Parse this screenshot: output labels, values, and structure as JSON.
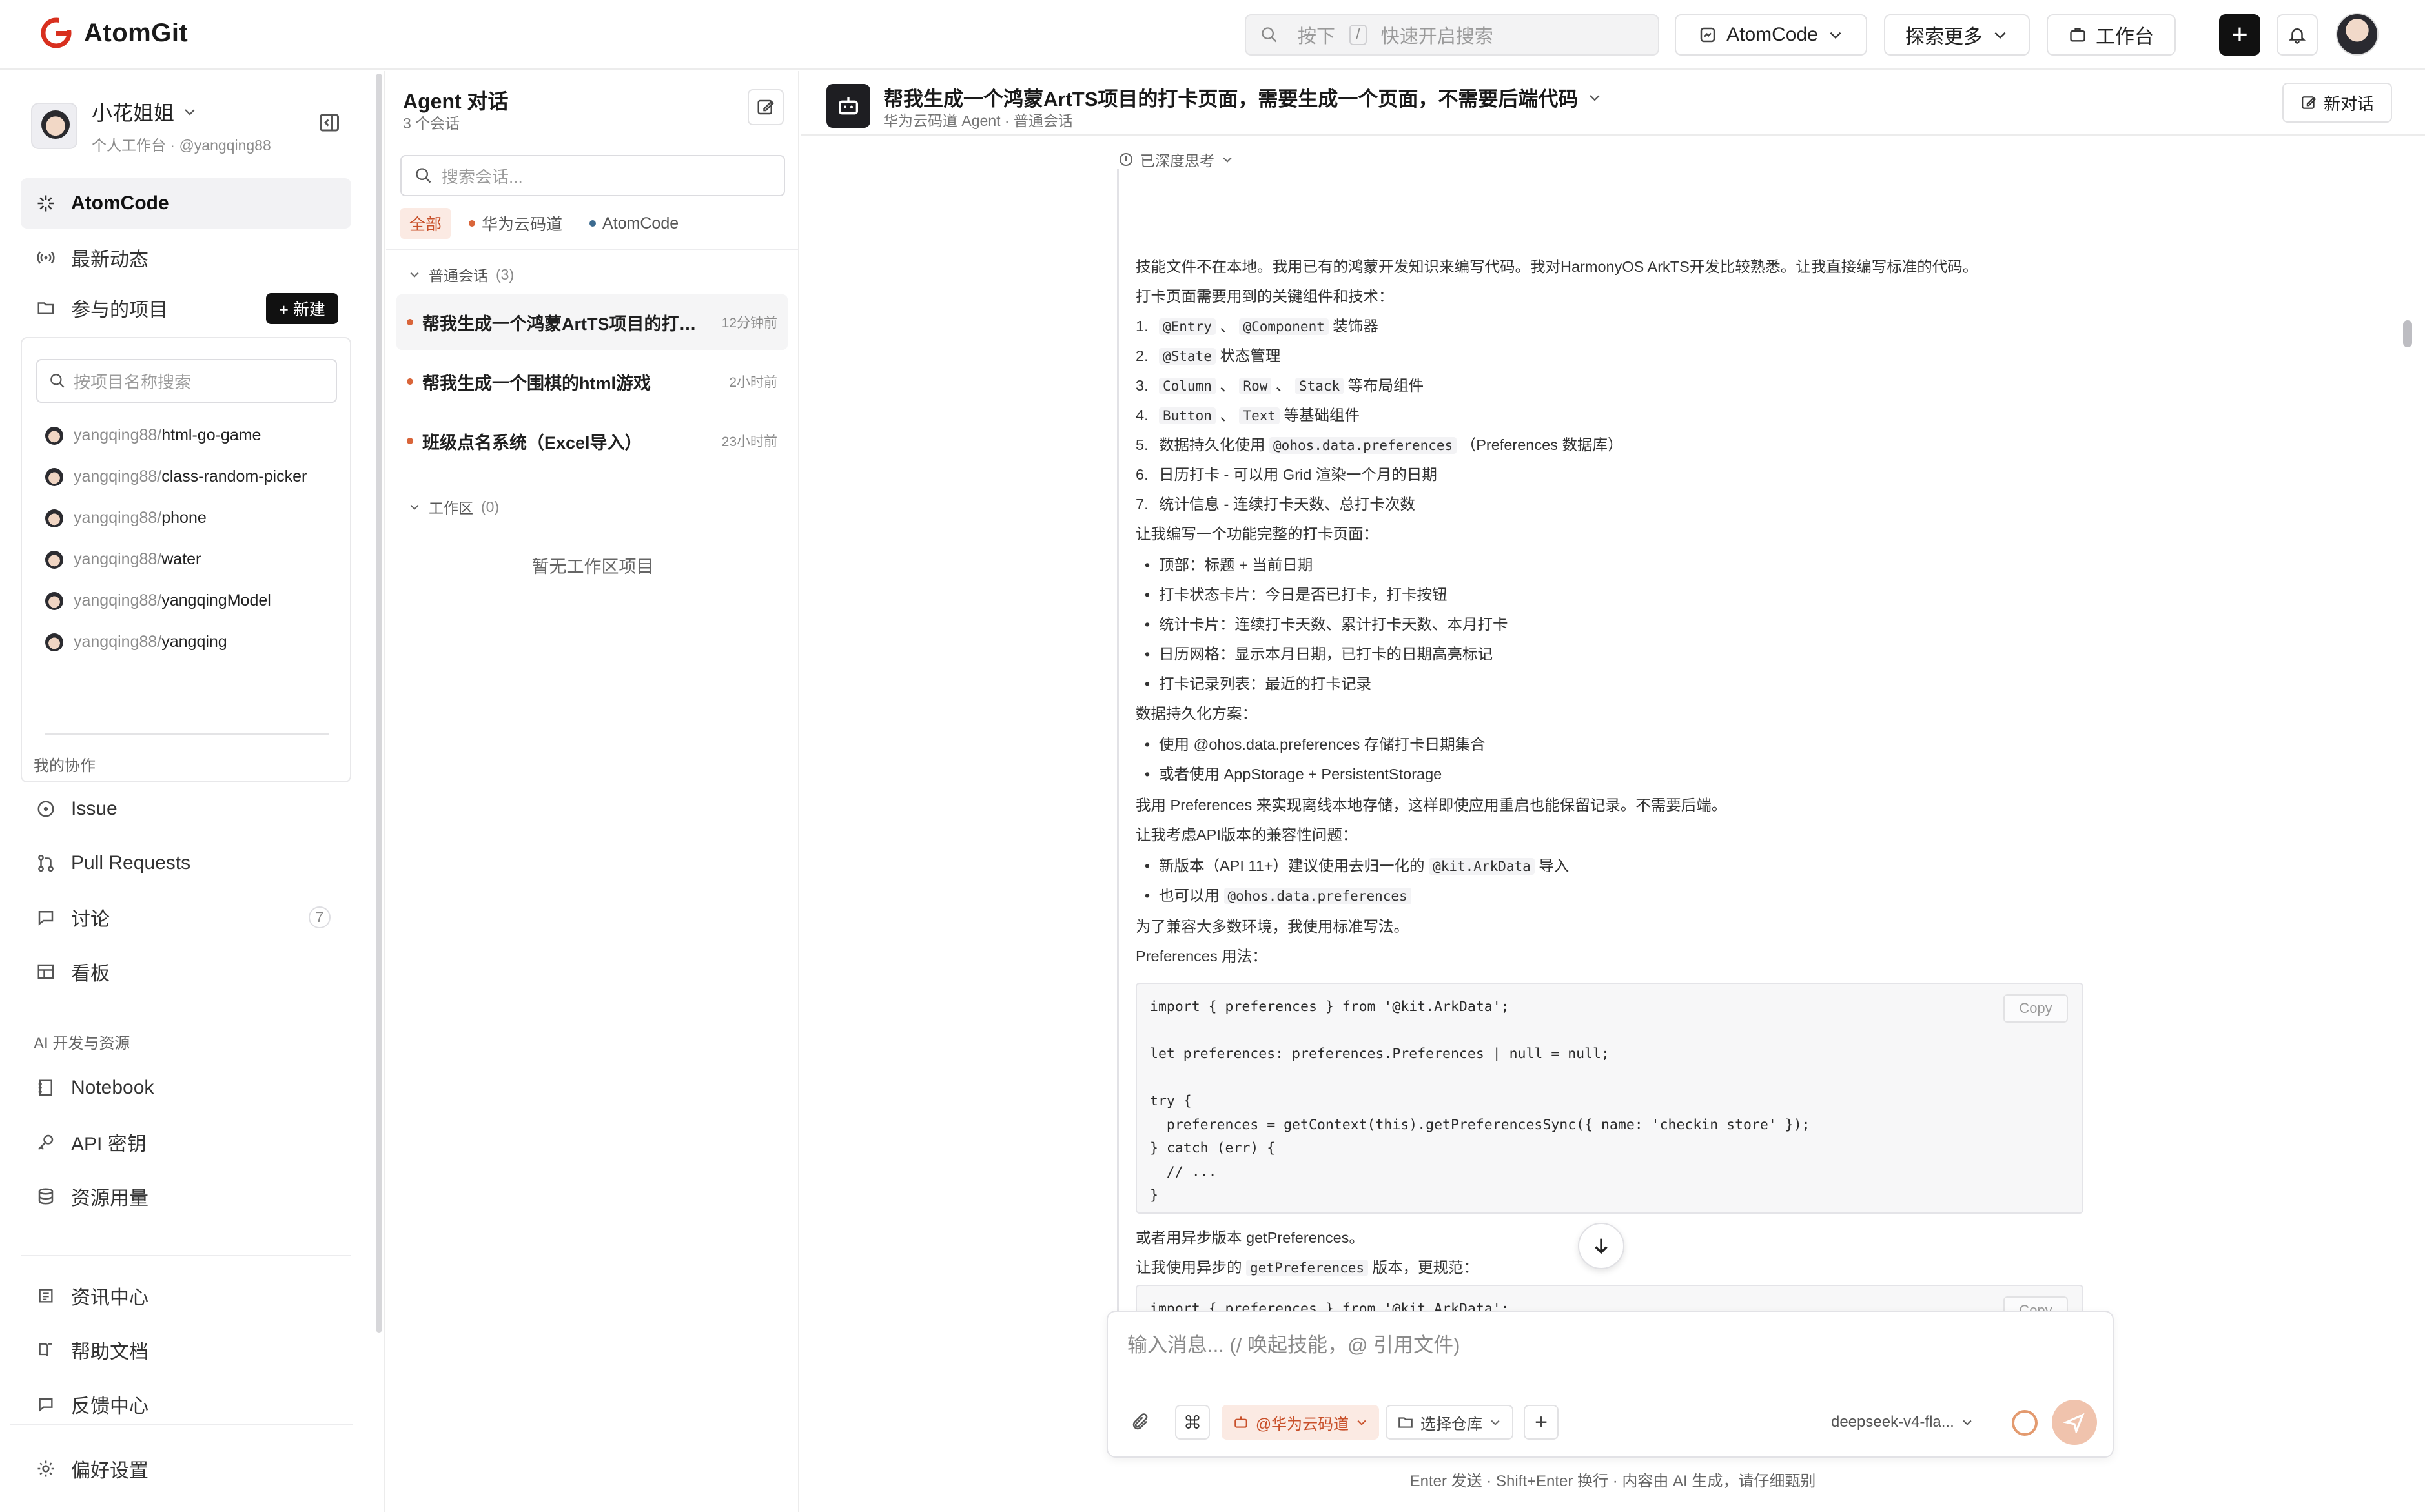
{
  "app": {
    "name": "AtomGit"
  },
  "topbar": {
    "search_placeholder_prefix": "按下",
    "search_key": "/",
    "search_placeholder_suffix": "快速开启搜索",
    "atomcode_label": "AtomCode",
    "explore_label": "探索更多",
    "workbench_label": "工作台"
  },
  "sidebar": {
    "user_name": "小花姐姐",
    "user_sub": "个人工作台 · @yangqing88",
    "nav": [
      {
        "label": "AtomCode",
        "icon": "sparkle-icon"
      },
      {
        "label": "最新动态",
        "icon": "broadcast-icon"
      },
      {
        "label": "参与的项目",
        "icon": "folder-icon"
      }
    ],
    "new_button": "+ 新建",
    "project_search_placeholder": "按项目名称搜索",
    "projects": [
      {
        "owner": "yangqing88/",
        "name": "html-go-game"
      },
      {
        "owner": "yangqing88/",
        "name": "class-random-picker"
      },
      {
        "owner": "yangqing88/",
        "name": "phone"
      },
      {
        "owner": "yangqing88/",
        "name": "water"
      },
      {
        "owner": "yangqing88/",
        "name": "yangqingModel"
      },
      {
        "owner": "yangqing88/",
        "name": "yangqing"
      }
    ],
    "collab_section": "我的协作",
    "collab": [
      {
        "label": "Issue",
        "icon": "issue-icon"
      },
      {
        "label": "Pull Requests",
        "icon": "pull-request-icon"
      },
      {
        "label": "讨论",
        "icon": "chat-icon",
        "badge": "7"
      },
      {
        "label": "看板",
        "icon": "board-icon"
      }
    ],
    "ai_section": "AI 开发与资源",
    "ai": [
      {
        "label": "Notebook",
        "icon": "notebook-icon"
      },
      {
        "label": "API 密钥",
        "icon": "key-icon"
      },
      {
        "label": "资源用量",
        "icon": "database-icon"
      }
    ],
    "bottom": [
      {
        "label": "资讯中心",
        "icon": "news-icon"
      },
      {
        "label": "帮助文档",
        "icon": "book-icon"
      },
      {
        "label": "反馈中心",
        "icon": "feedback-icon"
      }
    ],
    "settings": "偏好设置"
  },
  "conversations": {
    "title": "Agent 对话",
    "count": "3 个会话",
    "search_placeholder": "搜索会话...",
    "filters": [
      "全部",
      "华为云码道",
      "AtomCode"
    ],
    "group_normal": "普通会话",
    "group_normal_count": "(3)",
    "items": [
      {
        "title": "帮我生成一个鸿蒙ArtTS项目的打卡页面，需要生成一个页面，不需要后端代码",
        "time": "12分钟前"
      },
      {
        "title": "帮我生成一个围棋的html游戏",
        "time": "2小时前"
      },
      {
        "title": "班级点名系统（Excel导入）",
        "time": "23小时前"
      }
    ],
    "group_workspace": "工作区",
    "group_workspace_count": "(0)",
    "empty_workspace": "暂无工作区项目"
  },
  "main": {
    "title": "帮我生成一个鸿蒙ArtTS项目的打卡页面，需要生成一个页面，不需要后端代码",
    "subtitle": "华为云码道 Agent · 普通会话",
    "new_chat": "新对话",
    "thinking_label": "已深度思考",
    "copy_label": "Copy",
    "composer_placeholder": "输入消息...  (/ 唤起技能，@ 引用文件)",
    "agent_tag": "@华为云码道",
    "repo_select": "选择仓库",
    "model": "deepseek-v4-fla...",
    "footer": "Enter 发送 · Shift+Enter 换行 · 内容由 AI 生成，请仔细甄别",
    "lines": {
      "l1": "技能文件不在本地。我用已有的鸿蒙开发知识来编写代码。我对HarmonyOS ArkTS开发比较熟悉。让我直接编写标准的代码。",
      "l2": "打卡页面需要用到的关键组件和技术：",
      "n1a": "@Entry",
      "n1sep": " 、 ",
      "n1b": "@Component",
      "n1c": " 装饰器",
      "n2a": "@State",
      "n2c": " 状态管理",
      "n3a": "Column",
      "n3b": "Row",
      "n3d": "Stack",
      "n3c": " 等布局组件",
      "n4a": "Button",
      "n4b": "Text",
      "n4c": " 等基础组件",
      "n5pre": "数据持久化使用 ",
      "n5a": "@ohos.data.preferences",
      "n5c": " （Preferences 数据库）",
      "n6": "日历打卡 - 可以用 Grid 渲染一个月的日期",
      "n7": "统计信息 - 连续打卡天数、总打卡次数",
      "l3": "让我编写一个功能完整的打卡页面：",
      "b1": "顶部：标题 + 当前日期",
      "b2": "打卡状态卡片：今日是否已打卡，打卡按钮",
      "b3": "统计卡片：连续打卡天数、累计打卡天数、本月打卡",
      "b4": "日历网格：显示本月日期，已打卡的日期高亮标记",
      "b5": "打卡记录列表：最近的打卡记录",
      "l4": "数据持久化方案：",
      "b6": "使用 @ohos.data.preferences 存储打卡日期集合",
      "b7": "或者使用 AppStorage + PersistentStorage",
      "l5": "我用 Preferences 来实现离线本地存储，这样即使应用重启也能保留记录。不需要后端。",
      "l6": "让我考虑API版本的兼容性问题：",
      "b8pre": "新版本（API 11+）建议使用去归一化的 ",
      "b8a": "@kit.ArkData",
      "b8c": " 导入",
      "b9pre": "也可以用 ",
      "b9a": "@ohos.data.preferences",
      "l7": "为了兼容大多数环境，我使用标准写法。",
      "l8": "Preferences 用法：",
      "l9": "或者用异步版本 getPreferences。",
      "l10pre": "让我使用异步的 ",
      "l10a": "getPreferences",
      "l10c": " 版本，更规范："
    },
    "code1": "import { preferences } from '@kit.ArkData';\n\nlet preferences: preferences.Preferences | null = null;\n\ntry {\n  preferences = getContext(this).getPreferencesSync({ name: 'checkin_store' });\n} catch (err) {\n  // ...\n}",
    "code2": "import { preferences } from '@kit.ArkData';\n\nconst context = getContext(this);"
  }
}
